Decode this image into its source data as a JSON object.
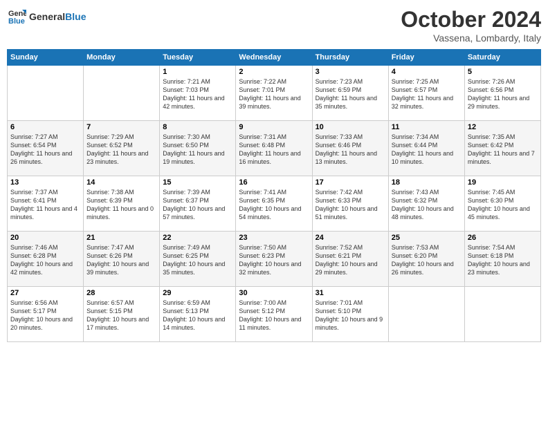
{
  "header": {
    "logo_line1": "General",
    "logo_line2": "Blue",
    "month": "October 2024",
    "location": "Vassena, Lombardy, Italy"
  },
  "days_of_week": [
    "Sunday",
    "Monday",
    "Tuesday",
    "Wednesday",
    "Thursday",
    "Friday",
    "Saturday"
  ],
  "weeks": [
    [
      {
        "num": "",
        "detail": ""
      },
      {
        "num": "",
        "detail": ""
      },
      {
        "num": "1",
        "detail": "Sunrise: 7:21 AM\nSunset: 7:03 PM\nDaylight: 11 hours and 42 minutes."
      },
      {
        "num": "2",
        "detail": "Sunrise: 7:22 AM\nSunset: 7:01 PM\nDaylight: 11 hours and 39 minutes."
      },
      {
        "num": "3",
        "detail": "Sunrise: 7:23 AM\nSunset: 6:59 PM\nDaylight: 11 hours and 35 minutes."
      },
      {
        "num": "4",
        "detail": "Sunrise: 7:25 AM\nSunset: 6:57 PM\nDaylight: 11 hours and 32 minutes."
      },
      {
        "num": "5",
        "detail": "Sunrise: 7:26 AM\nSunset: 6:56 PM\nDaylight: 11 hours and 29 minutes."
      }
    ],
    [
      {
        "num": "6",
        "detail": "Sunrise: 7:27 AM\nSunset: 6:54 PM\nDaylight: 11 hours and 26 minutes."
      },
      {
        "num": "7",
        "detail": "Sunrise: 7:29 AM\nSunset: 6:52 PM\nDaylight: 11 hours and 23 minutes."
      },
      {
        "num": "8",
        "detail": "Sunrise: 7:30 AM\nSunset: 6:50 PM\nDaylight: 11 hours and 19 minutes."
      },
      {
        "num": "9",
        "detail": "Sunrise: 7:31 AM\nSunset: 6:48 PM\nDaylight: 11 hours and 16 minutes."
      },
      {
        "num": "10",
        "detail": "Sunrise: 7:33 AM\nSunset: 6:46 PM\nDaylight: 11 hours and 13 minutes."
      },
      {
        "num": "11",
        "detail": "Sunrise: 7:34 AM\nSunset: 6:44 PM\nDaylight: 11 hours and 10 minutes."
      },
      {
        "num": "12",
        "detail": "Sunrise: 7:35 AM\nSunset: 6:42 PM\nDaylight: 11 hours and 7 minutes."
      }
    ],
    [
      {
        "num": "13",
        "detail": "Sunrise: 7:37 AM\nSunset: 6:41 PM\nDaylight: 11 hours and 4 minutes."
      },
      {
        "num": "14",
        "detail": "Sunrise: 7:38 AM\nSunset: 6:39 PM\nDaylight: 11 hours and 0 minutes."
      },
      {
        "num": "15",
        "detail": "Sunrise: 7:39 AM\nSunset: 6:37 PM\nDaylight: 10 hours and 57 minutes."
      },
      {
        "num": "16",
        "detail": "Sunrise: 7:41 AM\nSunset: 6:35 PM\nDaylight: 10 hours and 54 minutes."
      },
      {
        "num": "17",
        "detail": "Sunrise: 7:42 AM\nSunset: 6:33 PM\nDaylight: 10 hours and 51 minutes."
      },
      {
        "num": "18",
        "detail": "Sunrise: 7:43 AM\nSunset: 6:32 PM\nDaylight: 10 hours and 48 minutes."
      },
      {
        "num": "19",
        "detail": "Sunrise: 7:45 AM\nSunset: 6:30 PM\nDaylight: 10 hours and 45 minutes."
      }
    ],
    [
      {
        "num": "20",
        "detail": "Sunrise: 7:46 AM\nSunset: 6:28 PM\nDaylight: 10 hours and 42 minutes."
      },
      {
        "num": "21",
        "detail": "Sunrise: 7:47 AM\nSunset: 6:26 PM\nDaylight: 10 hours and 39 minutes."
      },
      {
        "num": "22",
        "detail": "Sunrise: 7:49 AM\nSunset: 6:25 PM\nDaylight: 10 hours and 35 minutes."
      },
      {
        "num": "23",
        "detail": "Sunrise: 7:50 AM\nSunset: 6:23 PM\nDaylight: 10 hours and 32 minutes."
      },
      {
        "num": "24",
        "detail": "Sunrise: 7:52 AM\nSunset: 6:21 PM\nDaylight: 10 hours and 29 minutes."
      },
      {
        "num": "25",
        "detail": "Sunrise: 7:53 AM\nSunset: 6:20 PM\nDaylight: 10 hours and 26 minutes."
      },
      {
        "num": "26",
        "detail": "Sunrise: 7:54 AM\nSunset: 6:18 PM\nDaylight: 10 hours and 23 minutes."
      }
    ],
    [
      {
        "num": "27",
        "detail": "Sunrise: 6:56 AM\nSunset: 5:17 PM\nDaylight: 10 hours and 20 minutes."
      },
      {
        "num": "28",
        "detail": "Sunrise: 6:57 AM\nSunset: 5:15 PM\nDaylight: 10 hours and 17 minutes."
      },
      {
        "num": "29",
        "detail": "Sunrise: 6:59 AM\nSunset: 5:13 PM\nDaylight: 10 hours and 14 minutes."
      },
      {
        "num": "30",
        "detail": "Sunrise: 7:00 AM\nSunset: 5:12 PM\nDaylight: 10 hours and 11 minutes."
      },
      {
        "num": "31",
        "detail": "Sunrise: 7:01 AM\nSunset: 5:10 PM\nDaylight: 10 hours and 9 minutes."
      },
      {
        "num": "",
        "detail": ""
      },
      {
        "num": "",
        "detail": ""
      }
    ]
  ]
}
